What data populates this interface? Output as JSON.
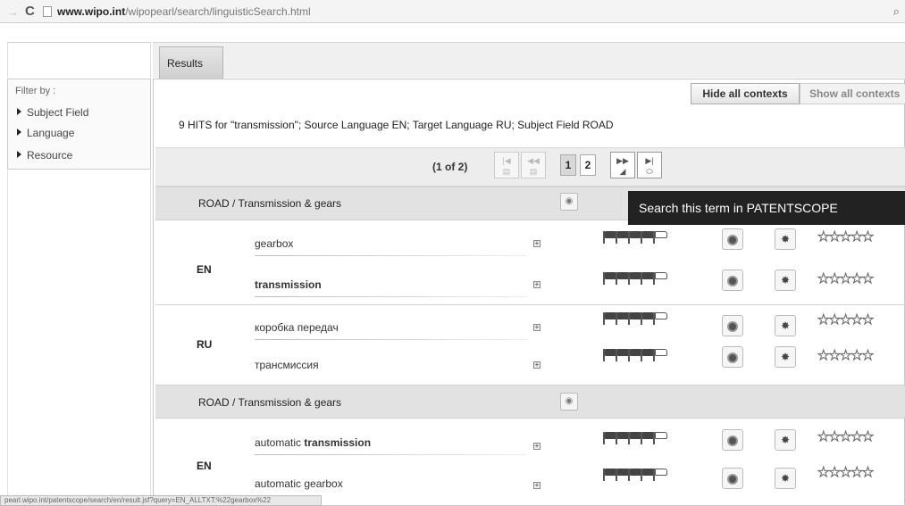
{
  "browser": {
    "url_domain": "www.wipo.int",
    "url_path": "/wipopearl/search/linguisticSearch.html",
    "back_icon": "back-arrow-icon",
    "reload_icon": "reload-icon",
    "zoom_icon": "magnifier-icon"
  },
  "tabs": {
    "results_label": "Results"
  },
  "filter": {
    "title": "Filter by :",
    "items": [
      "Subject Field",
      "Language",
      "Resource"
    ]
  },
  "context": {
    "hide_label": "Hide all contexts",
    "show_label": "Show all contexts"
  },
  "hits_text": "9 HITS for \"transmission\"; Source Language EN; Target Language RU; Subject Field ROAD",
  "pager": {
    "count": "(1 of 2)",
    "pages": [
      "1",
      "2"
    ],
    "current_page": "1"
  },
  "tooltip": "Search this term in PATENTSCOPE",
  "groups": [
    {
      "label": "ROAD / Transmission & gears",
      "langs": [
        {
          "code": "EN",
          "terms": [
            {
              "pre": "gearbox",
              "bold": "",
              "post": ""
            },
            {
              "pre": "",
              "bold": "transmission",
              "post": ""
            }
          ]
        },
        {
          "code": "RU",
          "terms": [
            {
              "pre": "коробка передач",
              "bold": "",
              "post": ""
            },
            {
              "pre": "трансмиссия",
              "bold": "",
              "post": ""
            }
          ]
        }
      ]
    },
    {
      "label": "ROAD / Transmission & gears",
      "langs": [
        {
          "code": "EN",
          "terms": [
            {
              "pre": "automatic ",
              "bold": "transmission",
              "post": ""
            },
            {
              "pre": "automatic gearbox",
              "bold": "",
              "post": ""
            }
          ]
        }
      ]
    }
  ],
  "reliability": {
    "filled_flags": 4,
    "total_flags": 5
  },
  "rating": {
    "stars_filled": 0,
    "stars_total": 5
  },
  "status_url": "pearl.wipo.int/patentscope/search/en/result.jsf?query=EN_ALLTXT:%22gearbox%22",
  "colors": {
    "tooltip_bg": "#222222",
    "header_bg": "#e2e2e2",
    "pager_bg": "#ededed"
  }
}
